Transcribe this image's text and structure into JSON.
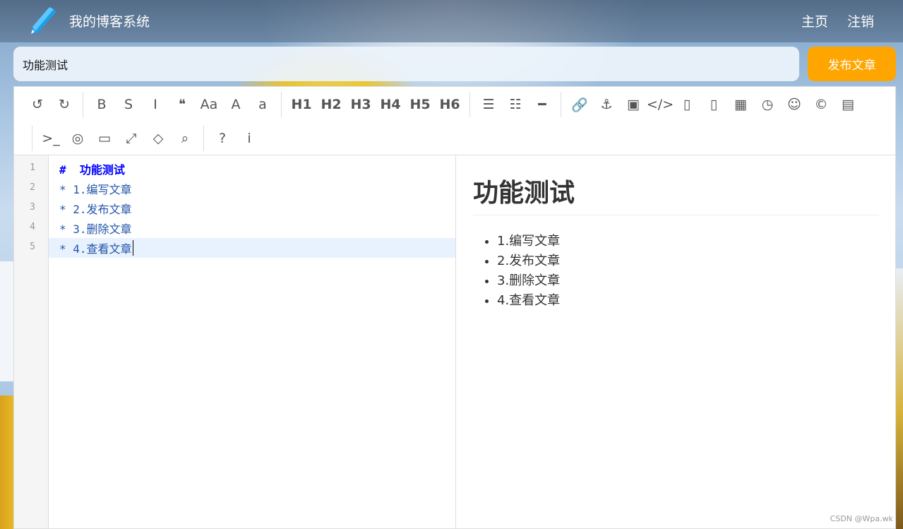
{
  "nav": {
    "site_title": "我的博客系统",
    "home_label": "主页",
    "logout_label": "注销"
  },
  "editor_header": {
    "title_value": "功能测试",
    "publish_label": "发布文章"
  },
  "toolbar": {
    "row1": [
      {
        "name": "undo-icon",
        "glyph": "↺"
      },
      {
        "name": "redo-icon",
        "glyph": "↻"
      },
      {
        "name": "sep"
      },
      {
        "name": "bold-icon",
        "glyph": "B"
      },
      {
        "name": "strikethrough-icon",
        "glyph": "S"
      },
      {
        "name": "italic-icon",
        "glyph": "I"
      },
      {
        "name": "quote-icon",
        "glyph": "❝"
      },
      {
        "name": "uppercase-icon",
        "glyph": "Aa"
      },
      {
        "name": "capitalize-icon",
        "glyph": "A"
      },
      {
        "name": "lowercase-icon",
        "glyph": "a"
      },
      {
        "name": "sep"
      },
      {
        "name": "h1-button",
        "glyph": "H1"
      },
      {
        "name": "h2-button",
        "glyph": "H2"
      },
      {
        "name": "h3-button",
        "glyph": "H3"
      },
      {
        "name": "h4-button",
        "glyph": "H4"
      },
      {
        "name": "h5-button",
        "glyph": "H5"
      },
      {
        "name": "h6-button",
        "glyph": "H6"
      },
      {
        "name": "sep"
      },
      {
        "name": "unordered-list-icon",
        "glyph": "☰"
      },
      {
        "name": "ordered-list-icon",
        "glyph": "☷"
      },
      {
        "name": "horizontal-rule-icon",
        "glyph": "━"
      },
      {
        "name": "sep"
      },
      {
        "name": "link-icon",
        "glyph": "🔗"
      },
      {
        "name": "anchor-icon",
        "glyph": "⚓"
      },
      {
        "name": "image-icon",
        "glyph": "▣"
      },
      {
        "name": "code-icon",
        "glyph": "</>"
      },
      {
        "name": "code-block-icon",
        "glyph": "▯"
      },
      {
        "name": "preformatted-icon",
        "glyph": "▯"
      },
      {
        "name": "table-icon",
        "glyph": "▦"
      },
      {
        "name": "datetime-icon",
        "glyph": "◷"
      },
      {
        "name": "emoji-icon",
        "glyph": "☺"
      },
      {
        "name": "html-entities-icon",
        "glyph": "©"
      },
      {
        "name": "pagebreak-icon",
        "glyph": "▤"
      }
    ],
    "row2": [
      {
        "name": "sep"
      },
      {
        "name": "terminal-icon",
        "glyph": ">_"
      },
      {
        "name": "hide-preview-icon",
        "glyph": "◎"
      },
      {
        "name": "watch-icon",
        "glyph": "▭"
      },
      {
        "name": "fullscreen-icon",
        "glyph": "⤢"
      },
      {
        "name": "clear-icon",
        "glyph": "◇"
      },
      {
        "name": "search-icon",
        "glyph": "⌕"
      },
      {
        "name": "sep"
      },
      {
        "name": "help-icon",
        "glyph": "?"
      },
      {
        "name": "info-icon",
        "glyph": "i"
      }
    ]
  },
  "code": {
    "line_numbers": [
      "1",
      "2",
      "3",
      "4",
      "5"
    ],
    "lines": [
      "#  功能测试",
      "* 1.编写文章",
      "* 2.发布文章",
      "* 3.删除文章",
      "* 4.查看文章"
    ]
  },
  "preview": {
    "heading": "功能测试",
    "items": [
      "1.编写文章",
      "2.发布文章",
      "3.删除文章",
      "4.查看文章"
    ]
  },
  "watermark": "CSDN @Wpa.wk",
  "colors": {
    "accent": "#ffa500",
    "code_text": "#2255aa",
    "heading_code": "#0000ff",
    "active_line": "#e8f2fe"
  }
}
